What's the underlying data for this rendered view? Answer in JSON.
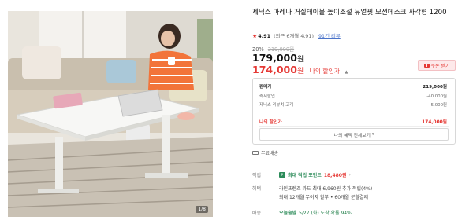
{
  "product": {
    "title": "제닉스 아레나 거실테이블 높이조절 듀얼핏 모션데스크 사각형 1200",
    "photo_count": "1/8"
  },
  "rating": {
    "star_icon": "star-icon",
    "score": "4.91",
    "meta": "(최근 6개월 4.91",
    "review_link": "91건 리뷰"
  },
  "pricing": {
    "discount_pct": "20%",
    "original_price": "219,000원",
    "price": "179,000",
    "price_unit": "원",
    "sale_price": "174,000",
    "sale_unit": "원",
    "sale_label": "나의 할인가",
    "coupon_button": "쿠폰 받기"
  },
  "breakdown": {
    "rows": [
      {
        "label": "판매가",
        "value": "219,000원"
      },
      {
        "label": "즉시할인",
        "value": "-40,000원"
      },
      {
        "label": "제닉스 리뷰치 고객",
        "value": "-5,000원"
      }
    ],
    "final_label": "나의 할인가",
    "final_value": "174,000원",
    "view_all_button": "나의 혜택 전체보기"
  },
  "shipping": {
    "label": "무료배송"
  },
  "benefits": {
    "points_label": "적립",
    "points_text": "최대 적립 포인트",
    "points_value": "18,480원",
    "card_label": "혜택",
    "card_line1": "라인프렌즈 카드 최대 6,960원 추가 적립(4%)",
    "card_line2": "최대 12개월 무이자 할부 • 60개월 분할결제",
    "arrival_label": "배송",
    "arrival_text": "오늘출발",
    "arrival_sub": "5/27 (화) 도착 확률 94%"
  },
  "colors": {
    "accent_red": "#e53935",
    "link_blue": "#4a73c9",
    "points_green": "#2d8c5a"
  }
}
